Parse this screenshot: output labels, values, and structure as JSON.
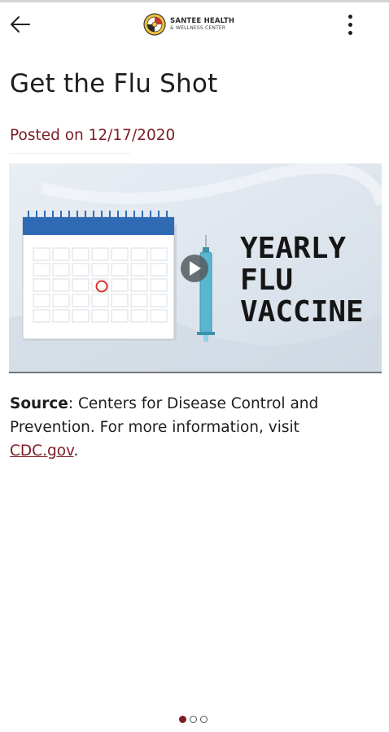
{
  "header": {
    "brand_line1": "SANTEE HEALTH",
    "brand_line2": "& WELLNESS CENTER",
    "back_icon": "arrow-left-icon",
    "menu_icon": "more-vertical-icon"
  },
  "post": {
    "title": "Get the Flu Shot",
    "posted": "Posted on 12/17/2020",
    "video": {
      "text_line1": "YEARLY",
      "text_line2": "FLU",
      "text_line3": "VACCINE",
      "play_icon": "play-icon"
    },
    "source_label": "Source",
    "source_text": ": Centers for Disease Control and Prevention. For more information, visit ",
    "source_link": "CDC.gov",
    "source_end": "."
  },
  "pager": {
    "count": 3,
    "active_index": 0
  },
  "colors": {
    "accent": "#7c1c26",
    "calendar_header": "#2f6bb5",
    "syringe": "#58b6cf"
  }
}
